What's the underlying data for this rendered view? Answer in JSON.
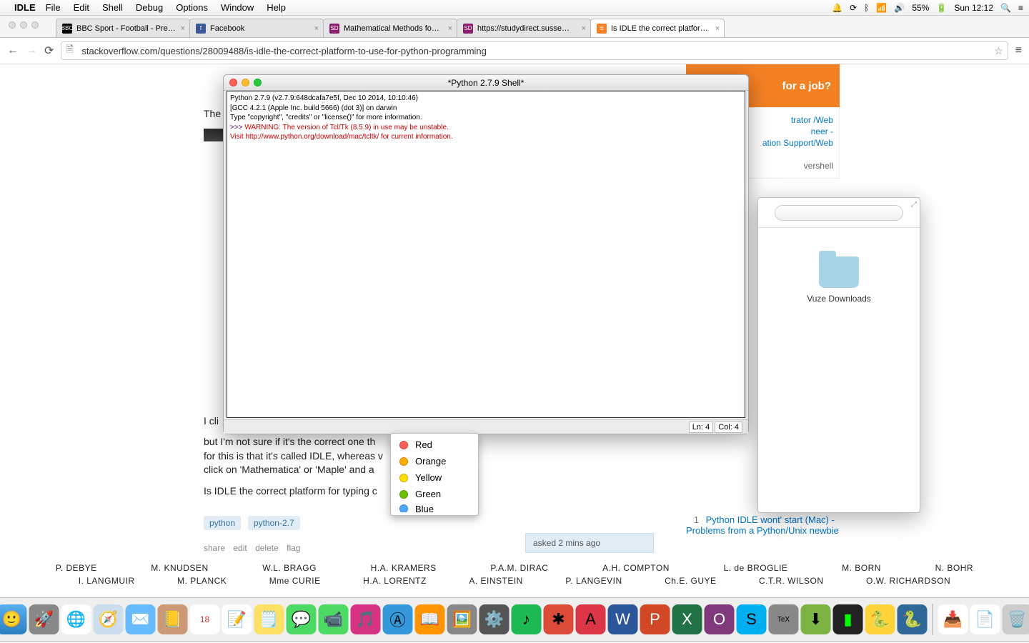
{
  "menubar": {
    "app": "IDLE",
    "items": [
      "File",
      "Edit",
      "Shell",
      "Debug",
      "Options",
      "Window",
      "Help"
    ],
    "battery": "55%",
    "clock": "Sun 12:12"
  },
  "browser": {
    "tabs": [
      {
        "label": "BBC Sport - Football - Pre…",
        "favtext": "BBC",
        "favbg": "#000"
      },
      {
        "label": "Facebook",
        "favtext": "f",
        "favbg": "#3b5998"
      },
      {
        "label": "Mathematical Methods fo…",
        "favtext": "SD",
        "favbg": "#8a1f6f"
      },
      {
        "label": "https://studydirect.susse…",
        "favtext": "SD",
        "favbg": "#8a1f6f"
      },
      {
        "label": "Is IDLE the correct platfor…",
        "favtext": "≣",
        "favbg": "#f48024",
        "active": true
      }
    ],
    "url": "stackoverflow.com/questions/28009488/is-idle-the-correct-platform-to-use-for-python-programming"
  },
  "idle": {
    "title": "*Python 2.7.9 Shell*",
    "line1": "Python 2.7.9 (v2.7.9:648dcafa7e5f, Dec 10 2014, 10:10:46)",
    "line2": "[GCC 4.2.1 (Apple Inc. build 5666) (dot 3)] on darwin",
    "line3": "Type \"copyright\", \"credits\" or \"license()\" for more information.",
    "prompt": ">>> ",
    "warn": "WARNING: The version of Tcl/Tk (8.5.9) in use may be unstable.",
    "visit": "Visit http://www.python.org/download/mac/tcltk/ for current information.",
    "status_ln": "Ln: 4",
    "status_col": "Col: 4"
  },
  "so": {
    "p1": "The",
    "p2": "I cli",
    "p3": "but I'm not sure if it's the correct one th",
    "p4": "for this is that it's called IDLE, whereas v",
    "p5": "click on 'Mathematica' or 'Maple' and a",
    "p6": "Is IDLE the correct platform for typing c",
    "tags": [
      "python",
      "python-2.7"
    ],
    "actions": [
      "share",
      "edit",
      "delete",
      "flag"
    ],
    "asked": "asked 2 mins ago"
  },
  "sidebar": {
    "jobtitle": "for a job?",
    "lines": [
      "trator /Web",
      "neer -",
      "ation Support/Web",
      "vershell"
    ]
  },
  "related": {
    "num": "1",
    "text": "Python IDLE wont' start (Mac) - Problems from a Python/Unix newbie"
  },
  "finder": {
    "label": "Vuze Downloads"
  },
  "colors": [
    "Red",
    "Orange",
    "Yellow",
    "Green",
    "Blue"
  ],
  "names1": [
    "P. DEBYE",
    "M. KNUDSEN",
    "W.L. BRAGG",
    "H.A. KRAMERS",
    "P.A.M. DIRAC",
    "A.H. COMPTON",
    "L. de BROGLIE",
    "M. BORN",
    "N. BOHR"
  ],
  "names2": [
    "I. LANGMUIR",
    "M. PLANCK",
    "Mme CURIE",
    "H.A. LORENTZ",
    "A. EINSTEIN",
    "P. LANGEVIN",
    "Ch.E. GUYE",
    "C.T.R. WILSON",
    "O.W. RICHARDSON"
  ]
}
